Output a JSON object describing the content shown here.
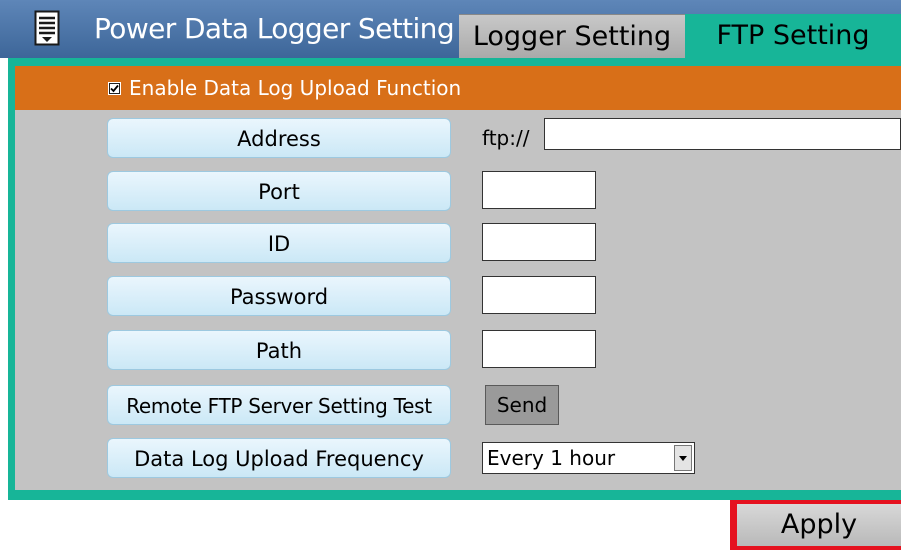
{
  "header": {
    "menu_icon": "menu-list-icon",
    "title": "Power Data Logger Setting",
    "tabs": [
      {
        "label": "Logger Setting",
        "active": false
      },
      {
        "label": "FTP Setting",
        "active": true
      }
    ]
  },
  "enable": {
    "label": "Enable Data Log Upload Function",
    "checked": true
  },
  "fields": {
    "address_label": "Address",
    "address_prefix": "ftp://",
    "address_value": "",
    "port_label": "Port",
    "port_value": "",
    "id_label": "ID",
    "id_value": "",
    "password_label": "Password",
    "password_value": "",
    "path_label": "Path",
    "path_value": "",
    "test_label": "Remote FTP Server Setting Test",
    "send_label": "Send",
    "frequency_label": "Data Log Upload Frequency",
    "frequency_value": "Every 1 hour"
  },
  "apply_label": "Apply",
  "colors": {
    "header": "#4a74a8",
    "accent": "#17b598",
    "enable_bar": "#d86f18",
    "content_bg": "#c3c3c3",
    "apply_border": "#e5121f"
  }
}
